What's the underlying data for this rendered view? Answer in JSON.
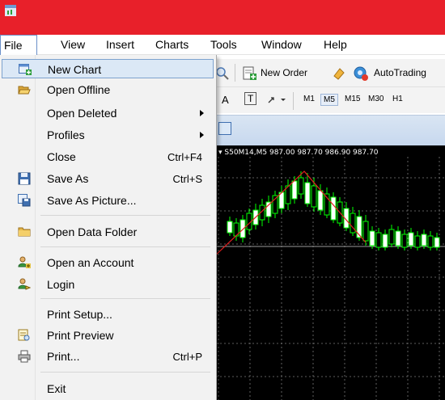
{
  "menubar": {
    "items": [
      {
        "label": "File"
      },
      {
        "label": "View"
      },
      {
        "label": "Insert"
      },
      {
        "label": "Charts"
      },
      {
        "label": "Tools"
      },
      {
        "label": "Window"
      },
      {
        "label": "Help"
      }
    ]
  },
  "toolbar": {
    "new_order": "New Order",
    "autotrading": "AutoTrading",
    "text_tool": "A",
    "label_tool": "T",
    "timeframes": [
      "M1",
      "M5",
      "M15",
      "M30",
      "H1"
    ],
    "active_timeframe": "M5"
  },
  "chart": {
    "caption": "▾ S50M14,M5  987.00 987.70 986.90 987.70",
    "background": "#000000",
    "candle_color": "#00ff00",
    "trend_color": "#e02020"
  },
  "file_menu": {
    "items": [
      {
        "label": "New Chart",
        "shortcut": "",
        "icon": "new-chart-icon",
        "highlighted": true
      },
      {
        "label": "Open Offline",
        "shortcut": "",
        "icon": "open-folder-icon"
      },
      {
        "label": "Open Deleted",
        "shortcut": "",
        "submenu": true
      },
      {
        "label": "Profiles",
        "shortcut": "",
        "submenu": true
      },
      {
        "label": "Close",
        "shortcut": "Ctrl+F4"
      },
      {
        "label": "Save As",
        "shortcut": "Ctrl+S",
        "icon": "save-icon"
      },
      {
        "label": "Save As Picture...",
        "shortcut": "",
        "icon": "save-picture-icon"
      },
      {
        "label": "Open Data Folder",
        "shortcut": "",
        "icon": "folder-icon"
      },
      {
        "label": "Open an Account",
        "shortcut": "",
        "icon": "add-account-icon"
      },
      {
        "label": "Login",
        "shortcut": "",
        "icon": "login-icon"
      },
      {
        "label": "Print Setup...",
        "shortcut": ""
      },
      {
        "label": "Print Preview",
        "shortcut": "",
        "icon": "print-preview-icon"
      },
      {
        "label": "Print...",
        "shortcut": "Ctrl+P",
        "icon": "printer-icon"
      },
      {
        "label": "Exit",
        "shortcut": ""
      }
    ]
  },
  "colors": {
    "title_bar": "#e8202a",
    "menu_highlight": "#dbe8f6"
  }
}
